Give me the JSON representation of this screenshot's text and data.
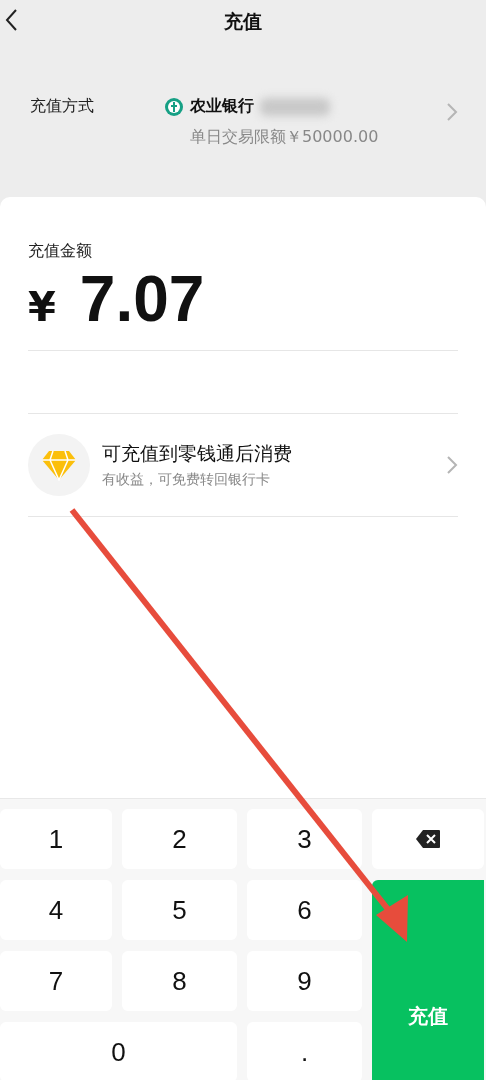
{
  "header": {
    "title": "充值"
  },
  "payment_method": {
    "label": "充值方式",
    "bank": "农业银行",
    "limit": "单日交易限额￥50000.00"
  },
  "amount": {
    "label": "充值金额",
    "currency": "¥",
    "value": "7.07"
  },
  "option": {
    "title": "可充值到零钱通后消费",
    "subtitle": "有收益，可免费转回银行卡"
  },
  "keypad": [
    {
      "kind": "digit",
      "label": "1"
    },
    {
      "kind": "digit",
      "label": "2"
    },
    {
      "kind": "digit",
      "label": "3"
    },
    {
      "kind": "backspace"
    },
    {
      "kind": "digit",
      "label": "4"
    },
    {
      "kind": "digit",
      "label": "5"
    },
    {
      "kind": "digit",
      "label": "6"
    },
    {
      "kind": "confirm",
      "label": "充值"
    },
    {
      "kind": "digit",
      "label": "7"
    },
    {
      "kind": "digit",
      "label": "8"
    },
    {
      "kind": "digit",
      "label": "9"
    },
    {
      "kind": "wide",
      "label": "0"
    },
    {
      "kind": "digit",
      "label": "."
    }
  ]
}
